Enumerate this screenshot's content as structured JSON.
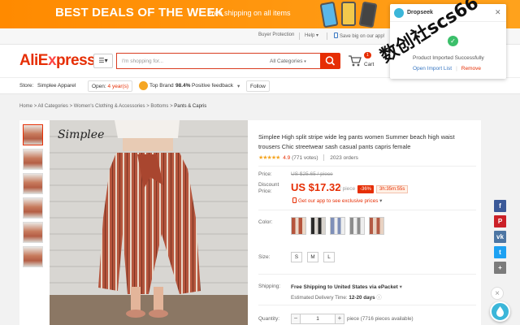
{
  "banner": {
    "title": "BEST DEALS OF THE WEEK",
    "subtitle": "Free shipping on all items"
  },
  "utilbar": {
    "buyer_protection": "Buyer Protection",
    "help": "Help",
    "app_promo": "Save big on our app!"
  },
  "header": {
    "logo_main": "AliE",
    "logo_x": "x",
    "logo_rest": "press",
    "search_placeholder": "I'm shopping for...",
    "search_category": "All Categories",
    "cart_count": "1",
    "cart_label": "Cart"
  },
  "store": {
    "store_label": "Store:",
    "store_name": "Simplee Apparel",
    "open_prefix": "Open:",
    "open_years": "4 year(s)",
    "top_brand": "Top Brand",
    "feedback_pct": "98.4%",
    "feedback_label": "Positive feedback",
    "follow": "Follow"
  },
  "breadcrumb": {
    "items": [
      "Home",
      "All Categories",
      "Women's Clothing & Accessories",
      "Bottoms",
      "Pants & Capris"
    ],
    "sep": ">"
  },
  "product": {
    "brand_overlay": "Simplee",
    "title": "Simplee High split stripe wide leg pants women Summer beach high waist trousers Chic streetwear sash casual pants capris female",
    "rating": "4.9",
    "votes": "(771 votes)",
    "orders": "2023 orders",
    "price_label": "Price:",
    "old_price": "US $25.65 / piece",
    "discount_label_1": "Discount",
    "discount_label_2": "Price:",
    "price": "US $17.32",
    "per_piece": "/ piece",
    "discount_pct": "-36%",
    "timer": "3h:35m:55s",
    "app_promo": "Get our app to see exclusive prices",
    "color_label": "Color:",
    "size_label": "Size:",
    "sizes": [
      "S",
      "M",
      "L"
    ],
    "shipping_label": "Shipping:",
    "shipping_text": "Free Shipping to United States via ePacket",
    "delivery_prefix": "Estimated Delivery Time:",
    "delivery_days": "12-20 days",
    "quantity_label": "Quantity:",
    "quantity": "1",
    "quantity_note": "piece (7716 pieces available)"
  },
  "popup": {
    "title": "Dropseek",
    "message": "Product Imported Successfully",
    "open_link": "Open Import List",
    "sep": "|",
    "remove_link": "Remove"
  },
  "watermark": "数创社scs66",
  "colors": {
    "accent": "#e62e04",
    "banner": "#ff8a00",
    "dropseek": "#3bb6d9"
  }
}
